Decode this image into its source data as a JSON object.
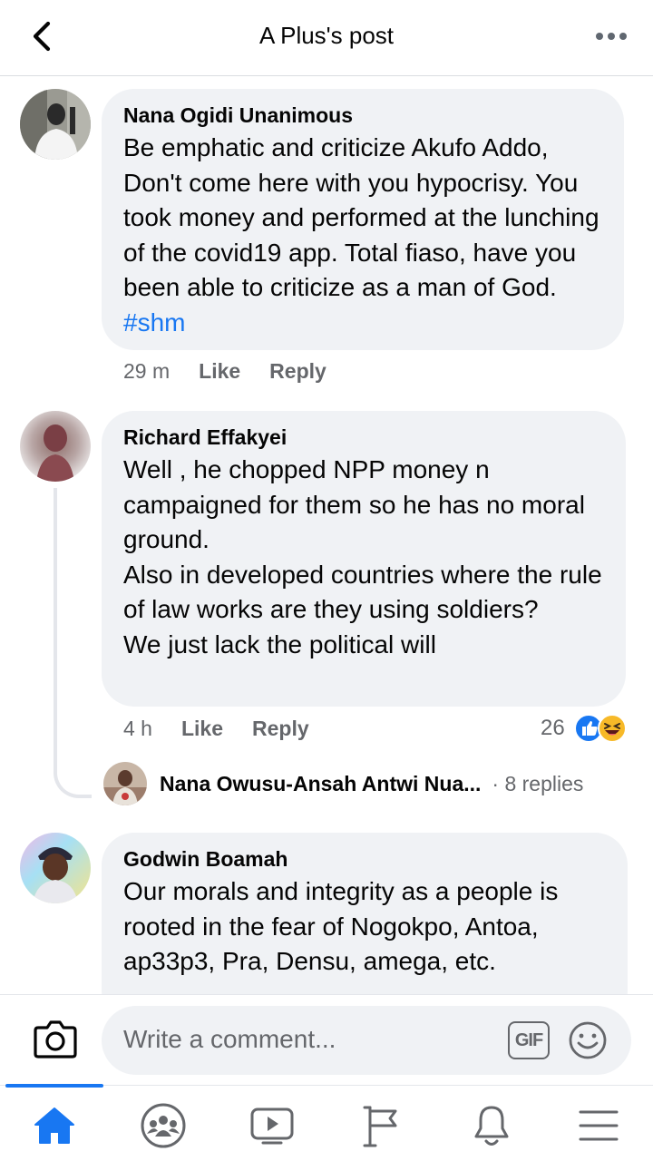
{
  "header": {
    "title": "A Plus's post",
    "back_icon": "chevron-left-icon",
    "more_icon": "more-dots-icon"
  },
  "comments": [
    {
      "author": "Nana Ogidi Unanimous",
      "text": "Be emphatic and criticize Akufo Addo, Don't come here with you hypocrisy. You took money and performed at the lunching of the covid19 app. Total fiaso, have you been able to criticize as a man of God.",
      "hashtag": "#shm",
      "time": "29 m",
      "like_label": "Like",
      "reply_label": "Reply"
    },
    {
      "author": "Richard Effakyei",
      "text": "Well , he chopped NPP money n campaigned for them so he has no moral ground.\nAlso in developed countries where the rule of law works are they using soldiers?\nWe just lack the political will",
      "time": "4 h",
      "like_label": "Like",
      "reply_label": "Reply",
      "reaction_count": "26",
      "reactions": [
        "like-reaction-icon",
        "haha-reaction-icon"
      ],
      "reply_preview": {
        "name": "Nana Owusu-Ansah Antwi Nua...",
        "count": "· 8 replies"
      }
    },
    {
      "author": "Godwin Boamah",
      "text": "Our morals and integrity as a people is rooted in the fear of Nogokpo, Antoa, ap33p3, Pra, Densu, amega, etc."
    }
  ],
  "composer": {
    "placeholder": "Write a comment...",
    "gif_label": "GIF",
    "camera_icon": "camera-icon",
    "emoji_icon": "emoji-icon"
  },
  "bottom_nav": {
    "items": [
      "home-icon",
      "groups-icon",
      "watch-icon",
      "pages-flag-icon",
      "notifications-bell-icon",
      "menu-icon"
    ],
    "active_item": "home-icon",
    "active_color": "#1877f2",
    "inactive_color": "#65676b"
  },
  "colors": {
    "accent": "#1877f2",
    "bubble": "#f0f2f5",
    "secondary_text": "#65676b"
  }
}
